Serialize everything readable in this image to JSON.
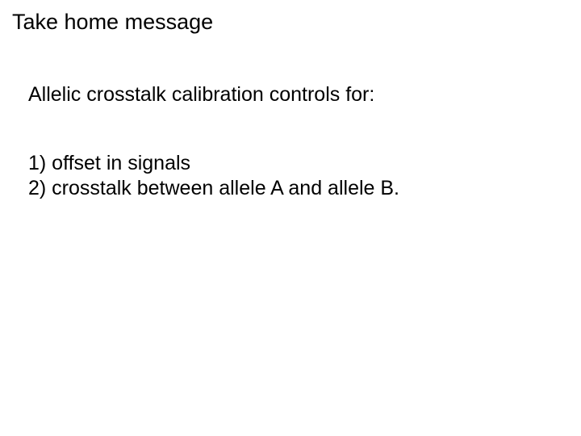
{
  "heading": "Take home message",
  "intro": "Allelic crosstalk calibration controls for:",
  "items": [
    "1) offset in signals",
    "2) crosstalk between allele A and allele B."
  ]
}
